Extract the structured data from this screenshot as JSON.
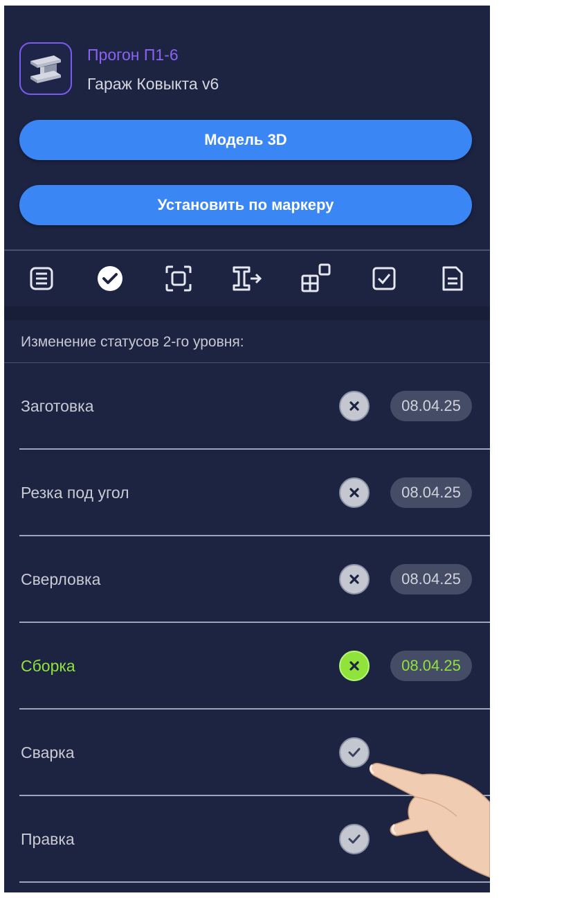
{
  "header": {
    "app_icon": "steel-beam-icon",
    "title": "Прогон П1-6",
    "subtitle": "Гараж Ковыкта v6",
    "buttons": {
      "model_3d": "Модель 3D",
      "set_by_marker": "Установить по маркеру"
    }
  },
  "tabs": [
    {
      "icon": "list-icon",
      "active": false
    },
    {
      "icon": "check-circle-icon",
      "active": true
    },
    {
      "icon": "frame-icon",
      "active": false
    },
    {
      "icon": "beam-export-icon",
      "active": false
    },
    {
      "icon": "grid-squares-icon",
      "active": false
    },
    {
      "icon": "checkbox-icon",
      "active": false
    },
    {
      "icon": "document-icon",
      "active": false
    }
  ],
  "section": {
    "title": "Изменение статусов 2-го уровня:"
  },
  "statuses": [
    {
      "label": "Заготовка",
      "state": "done",
      "date": "08.04.25",
      "active": false
    },
    {
      "label": "Резка под угол",
      "state": "done",
      "date": "08.04.25",
      "active": false
    },
    {
      "label": "Сверловка",
      "state": "done",
      "date": "08.04.25",
      "active": false
    },
    {
      "label": "Сборка",
      "state": "done",
      "date": "08.04.25",
      "active": true
    },
    {
      "label": "Сварка",
      "state": "pending",
      "date": "",
      "active": false
    },
    {
      "label": "Правка",
      "state": "pending",
      "date": "",
      "active": false
    }
  ],
  "colors": {
    "background": "#1d2442",
    "accent_blue": "#3b86f5",
    "accent_purple": "#8a63f5",
    "active_green": "#8fe33a"
  }
}
